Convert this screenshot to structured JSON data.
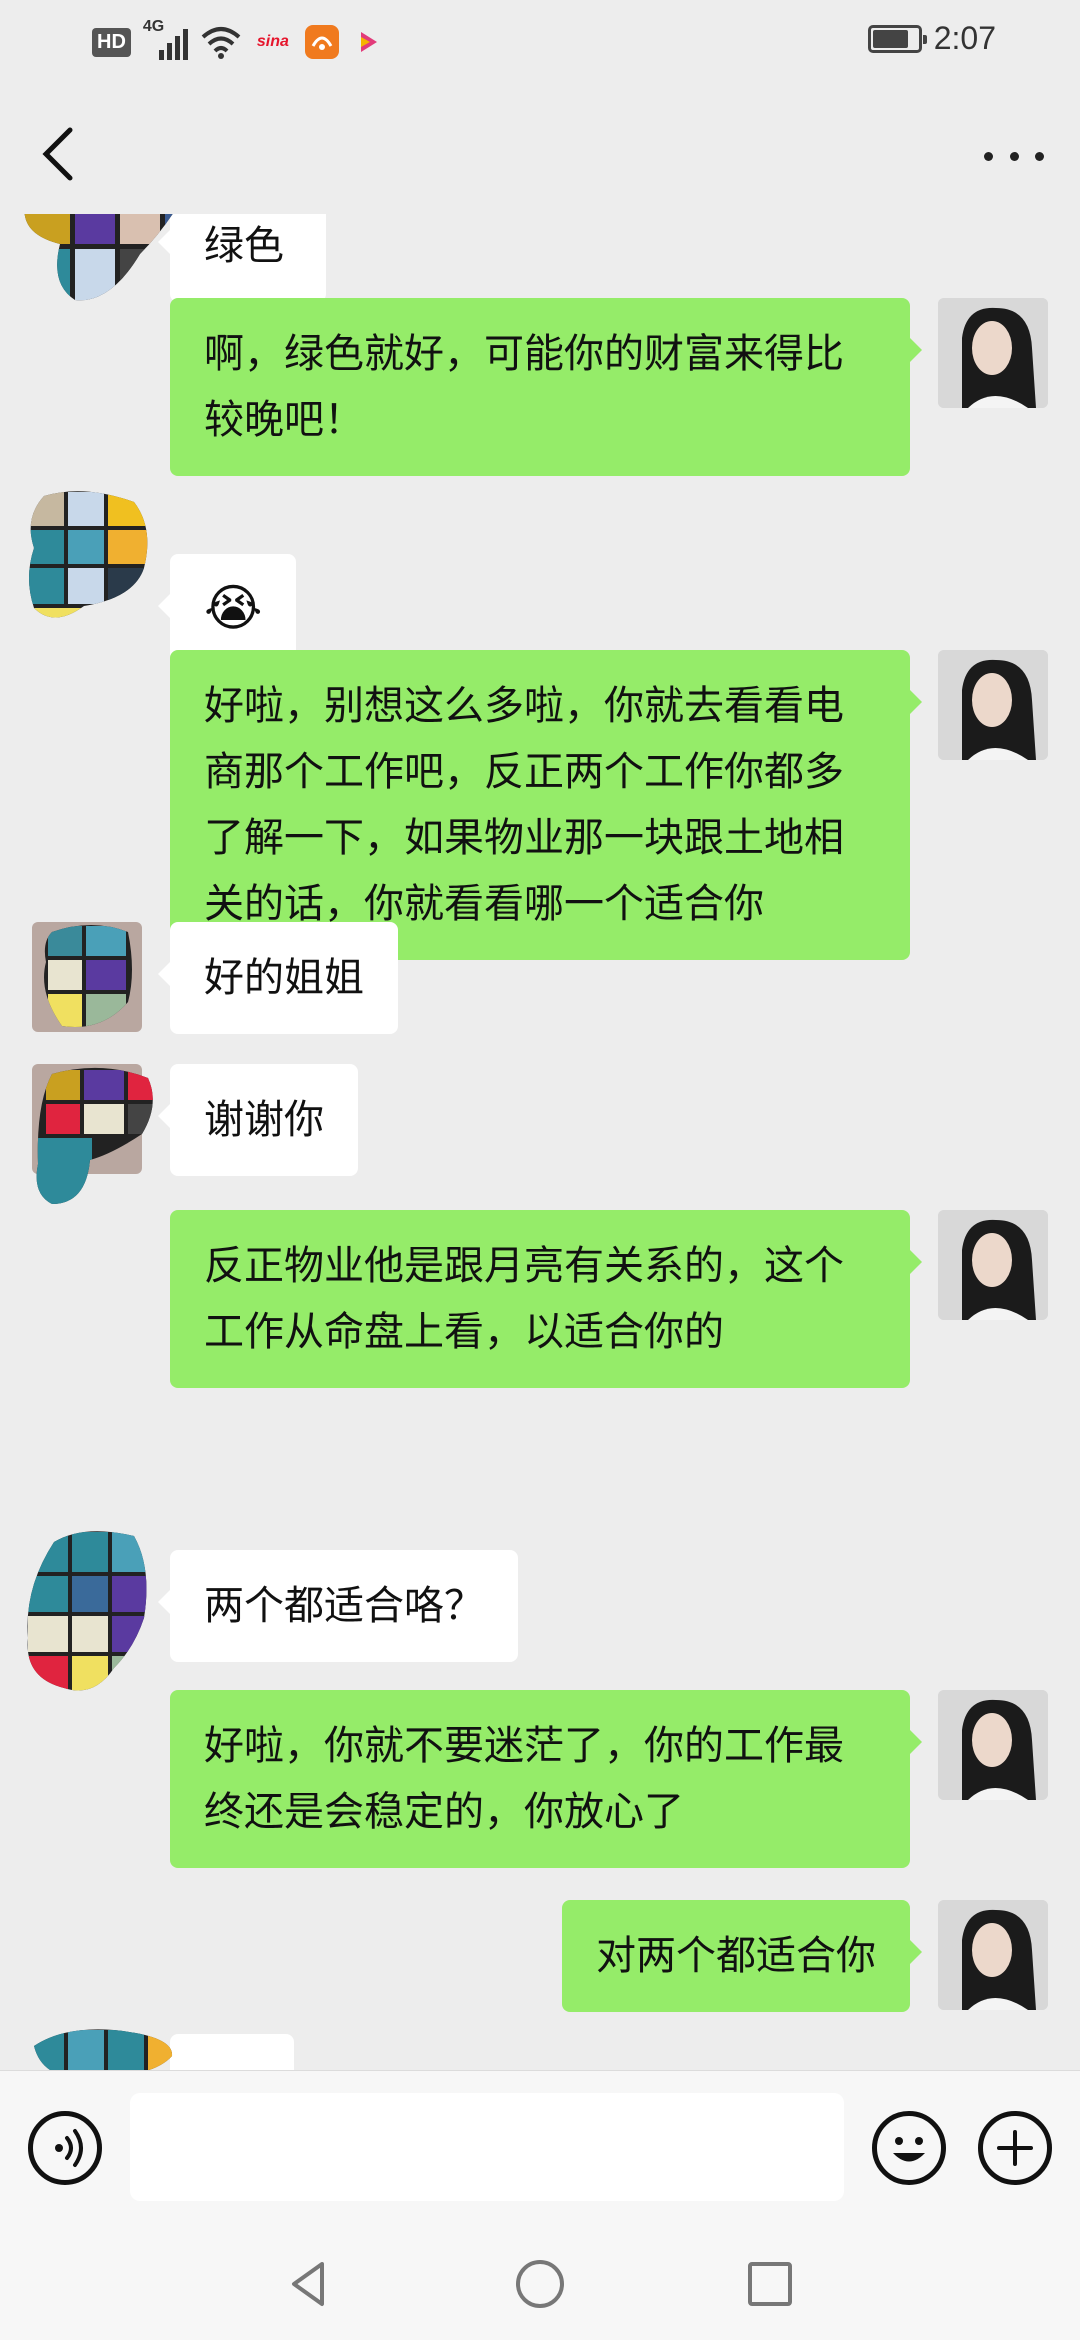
{
  "status_bar": {
    "hd": "HD",
    "network": "4G",
    "apps": [
      "sina-icon",
      "uc-browser-icon",
      "video-app-icon"
    ],
    "sina_label": "sina",
    "battery_level": 0.8,
    "time": "2:07"
  },
  "header": {
    "back_icon": "chevron-left-icon",
    "more_icon": "more-dots-icon"
  },
  "messages": [
    {
      "from": "them",
      "text": "绿色",
      "partial": true
    },
    {
      "from": "me",
      "text": "啊，绿色就好，可能你的财富来得比较晚吧！"
    },
    {
      "from": "them",
      "text": "😭",
      "kind": "emoji"
    },
    {
      "from": "me",
      "text": "好啦，别想这么多啦，你就去看看电商那个工作吧，反正两个工作你都多了解一下，如果物业那一块跟土地相关的话，你就看看哪一个适合你"
    },
    {
      "from": "them",
      "text": "好的姐姐"
    },
    {
      "from": "them",
      "text": "谢谢你"
    },
    {
      "from": "me",
      "text": "反正物业他是跟月亮有关系的，这个工作从命盘上看，以适合你的"
    },
    {
      "from": "them",
      "text": "两个都适合咯？"
    },
    {
      "from": "me",
      "text": "好啦，你就不要迷茫了，你的工作最终还是会稳定的，你放心了"
    },
    {
      "from": "me",
      "text": "对两个都适合你"
    }
  ],
  "input_bar": {
    "voice_icon": "voice-icon",
    "message_value": "",
    "emoji_icon": "smiley-icon",
    "plus_icon": "plus-icon"
  },
  "nav_bar": {
    "back": "triangle-back-icon",
    "home": "circle-home-icon",
    "recents": "square-recents-icon"
  },
  "colors": {
    "background": "#ededed",
    "sent_bubble": "#95ec69",
    "received_bubble": "#ffffff"
  }
}
